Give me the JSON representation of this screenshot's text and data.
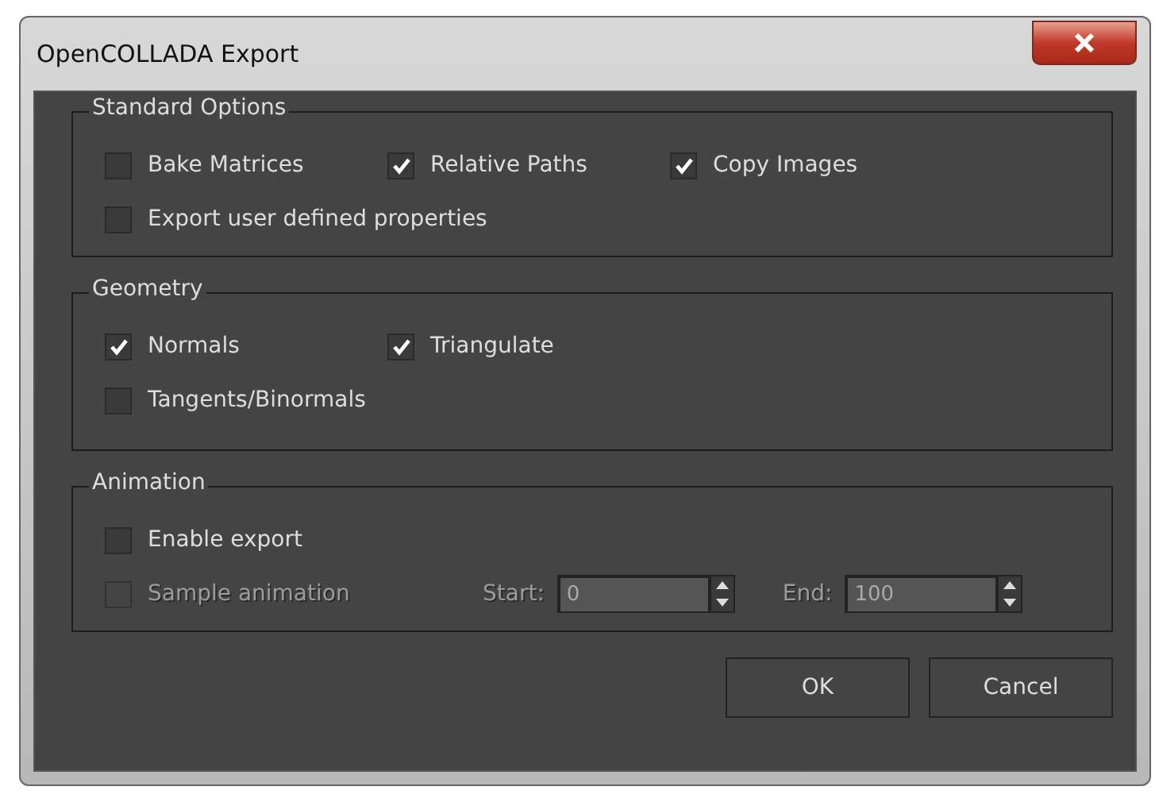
{
  "window": {
    "title": "OpenCOLLADA Export"
  },
  "groups": [
    {
      "title": "Standard Options",
      "rows": [
        [
          {
            "kind": "checkbox",
            "label": "Bake Matrices",
            "checked": false,
            "disabled": false
          },
          {
            "kind": "checkbox",
            "label": "Relative Paths",
            "checked": true,
            "disabled": false
          },
          {
            "kind": "checkbox",
            "label": "Copy Images",
            "checked": true,
            "disabled": false
          }
        ],
        [
          {
            "kind": "checkbox",
            "label": "Export user defined properties",
            "checked": false,
            "disabled": false
          }
        ]
      ]
    },
    {
      "title": "Geometry",
      "rows": [
        [
          {
            "kind": "checkbox",
            "label": "Normals",
            "checked": true,
            "disabled": false
          },
          {
            "kind": "checkbox",
            "label": "Triangulate",
            "checked": true,
            "disabled": false
          }
        ],
        [
          {
            "kind": "checkbox",
            "label": "Tangents/Binormals",
            "checked": false,
            "disabled": false
          }
        ]
      ]
    },
    {
      "title": "Animation",
      "rows": [
        [
          {
            "kind": "checkbox",
            "label": "Enable export",
            "checked": false,
            "disabled": false
          }
        ],
        [
          {
            "kind": "checkbox",
            "label": "Sample animation",
            "checked": false,
            "disabled": true
          },
          {
            "kind": "spinner",
            "label": "Start:",
            "value": "0",
            "disabled": true
          },
          {
            "kind": "spinner",
            "label": "End:",
            "value": "100",
            "disabled": true
          }
        ]
      ]
    }
  ],
  "buttons": [
    "OK",
    "Cancel"
  ]
}
